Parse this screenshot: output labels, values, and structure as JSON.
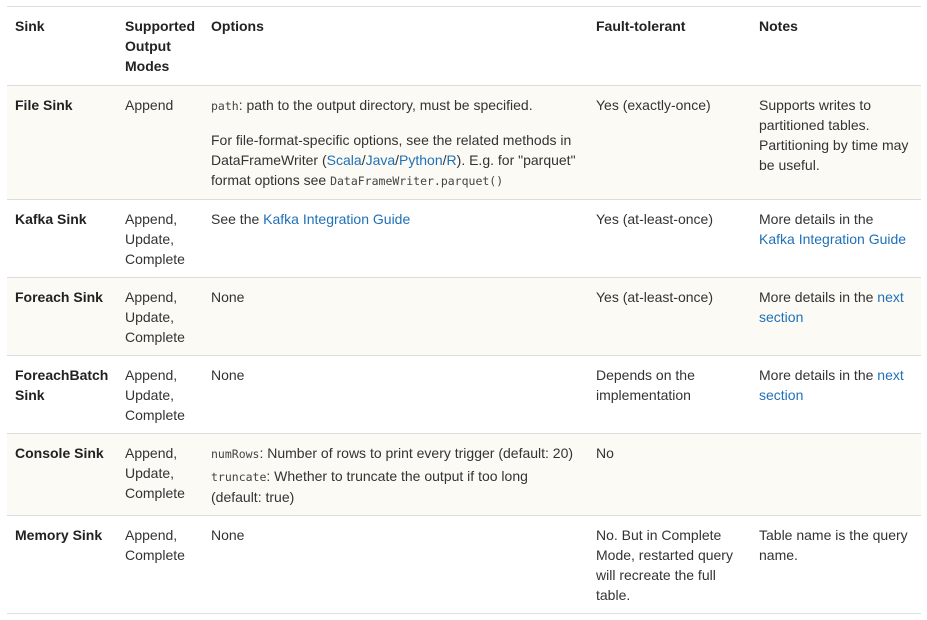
{
  "headers": {
    "sink": "Sink",
    "modes": "Supported Output Modes",
    "options": "Options",
    "fault": "Fault-tolerant",
    "notes": "Notes"
  },
  "rows": {
    "file": {
      "sink": "File Sink",
      "modes": "Append",
      "opt_code": "path",
      "opt_text1": ": path to the output directory, must be specified.",
      "opt_text2a": "For file-format-specific options, see the related methods in DataFrameWriter (",
      "link_scala": "Scala",
      "link_java": "Java",
      "link_python": "Python",
      "link_r": "R",
      "opt_text2b": "). E.g. for \"parquet\" format options see ",
      "opt_code2": "DataFrameWriter.parquet()",
      "fault": "Yes (exactly-once)",
      "notes": "Supports writes to partitioned tables. Partitioning by time may be useful."
    },
    "kafka": {
      "sink": "Kafka Sink",
      "modes": "Append, Update, Complete",
      "opt_prefix": "See the ",
      "opt_link": "Kafka Integration Guide",
      "fault": "Yes (at-least-once)",
      "notes_prefix": "More details in the ",
      "notes_link": "Kafka Integration Guide"
    },
    "foreach": {
      "sink": "Foreach Sink",
      "modes": "Append, Update, Complete",
      "options": "None",
      "fault": "Yes (at-least-once)",
      "notes_prefix": "More details in the ",
      "notes_link": "next section"
    },
    "foreachbatch": {
      "sink": "ForeachBatch Sink",
      "modes": "Append, Update, Complete",
      "options": "None",
      "fault": "Depends on the implementation",
      "notes_prefix": "More details in the ",
      "notes_link": "next section"
    },
    "console": {
      "sink": "Console Sink",
      "modes": "Append, Update, Complete",
      "opt_code1": "numRows",
      "opt_text1": ": Number of rows to print every trigger (default: 20)",
      "opt_code2": "truncate",
      "opt_text2": ": Whether to truncate the output if too long (default: true)",
      "fault": "No",
      "notes": ""
    },
    "memory": {
      "sink": "Memory Sink",
      "modes": "Append, Complete",
      "options": "None",
      "fault": "No. But in Complete Mode, restarted query will recreate the full table.",
      "notes": "Table name is the query name."
    }
  }
}
